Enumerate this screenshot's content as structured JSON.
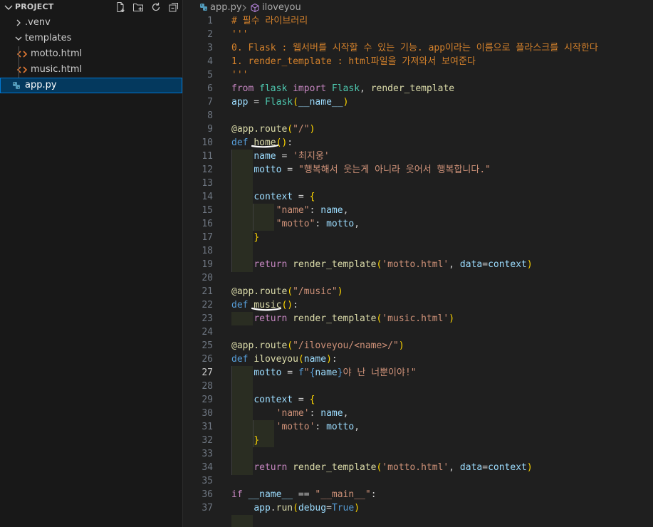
{
  "explorer": {
    "title": "PROJECT",
    "actions": [
      {
        "name": "new-file-icon"
      },
      {
        "name": "new-folder-icon"
      },
      {
        "name": "refresh-icon"
      },
      {
        "name": "collapse-all-icon"
      }
    ],
    "items": [
      {
        "label": ".venv",
        "type": "folder",
        "expanded": false
      },
      {
        "label": "templates",
        "type": "folder",
        "expanded": true
      },
      {
        "label": "motto.html",
        "type": "html"
      },
      {
        "label": "music.html",
        "type": "html"
      },
      {
        "label": "app.py",
        "type": "python",
        "selected": true
      }
    ]
  },
  "breadcrumb": {
    "file": "app.py",
    "symbol": "iloveyou"
  },
  "editor": {
    "active_line": 27,
    "lines": [
      [
        [
          "t-comment",
          "# 필수 라이브러리"
        ]
      ],
      [
        [
          "t-comment",
          "'''"
        ]
      ],
      [
        [
          "t-comment",
          "0. Flask : 웹서버를 시작할 수 있는 기능. app이라는 이름으로 플라스크를 시작한다"
        ]
      ],
      [
        [
          "t-comment",
          "1. render_template : html파일을 가져와서 보여준다"
        ]
      ],
      [
        [
          "t-comment",
          "'''"
        ]
      ],
      [
        [
          "t-ctrl",
          "from"
        ],
        [
          "t-plain",
          " "
        ],
        [
          "t-cls",
          "flask"
        ],
        [
          "t-plain",
          " "
        ],
        [
          "t-ctrl",
          "import"
        ],
        [
          "t-plain",
          " "
        ],
        [
          "t-cls",
          "Flask"
        ],
        [
          "t-plain",
          ", "
        ],
        [
          "t-fn",
          "render_template"
        ]
      ],
      [
        [
          "t-var",
          "app"
        ],
        [
          "t-plain",
          " = "
        ],
        [
          "t-cls",
          "Flask"
        ],
        [
          "t-br1",
          "("
        ],
        [
          "t-var",
          "__name__"
        ],
        [
          "t-br1",
          ")"
        ]
      ],
      [],
      [
        [
          "t-fn",
          "@app.route"
        ],
        [
          "t-br1",
          "("
        ],
        [
          "t-str",
          "\"/\""
        ],
        [
          "t-br1",
          ")"
        ]
      ],
      [
        [
          "t-kw",
          "def"
        ],
        [
          "t-plain",
          " "
        ],
        [
          "t-fn",
          "home"
        ],
        [
          "t-br1",
          "()"
        ],
        [
          "t-plain",
          ":"
        ]
      ],
      [
        [
          "t-plain",
          "    "
        ],
        [
          "t-var",
          "name"
        ],
        [
          "t-plain",
          " = "
        ],
        [
          "t-str",
          "'최지웅'"
        ]
      ],
      [
        [
          "t-plain",
          "    "
        ],
        [
          "t-var",
          "motto"
        ],
        [
          "t-plain",
          " = "
        ],
        [
          "t-str",
          "\"행복해서 웃는게 아니라 웃어서 행복합니다.\""
        ]
      ],
      [],
      [
        [
          "t-plain",
          "    "
        ],
        [
          "t-var",
          "context"
        ],
        [
          "t-plain",
          " = "
        ],
        [
          "t-br1",
          "{"
        ]
      ],
      [
        [
          "t-plain",
          "        "
        ],
        [
          "t-str",
          "\"name\""
        ],
        [
          "t-plain",
          ": "
        ],
        [
          "t-var",
          "name"
        ],
        [
          "t-plain",
          ","
        ]
      ],
      [
        [
          "t-plain",
          "        "
        ],
        [
          "t-str",
          "\"motto\""
        ],
        [
          "t-plain",
          ": "
        ],
        [
          "t-var",
          "motto"
        ],
        [
          "t-plain",
          ","
        ]
      ],
      [
        [
          "t-plain",
          "    "
        ],
        [
          "t-br1",
          "}"
        ]
      ],
      [],
      [
        [
          "t-plain",
          "    "
        ],
        [
          "t-ctrl",
          "return"
        ],
        [
          "t-plain",
          " "
        ],
        [
          "t-fn",
          "render_template"
        ],
        [
          "t-br1",
          "("
        ],
        [
          "t-str",
          "'motto.html'"
        ],
        [
          "t-plain",
          ", "
        ],
        [
          "t-var",
          "data"
        ],
        [
          "t-plain",
          "="
        ],
        [
          "t-var",
          "context"
        ],
        [
          "t-br1",
          ")"
        ]
      ],
      [],
      [
        [
          "t-fn",
          "@app.route"
        ],
        [
          "t-br1",
          "("
        ],
        [
          "t-str",
          "\"/music\""
        ],
        [
          "t-br1",
          ")"
        ]
      ],
      [
        [
          "t-kw",
          "def"
        ],
        [
          "t-plain",
          " "
        ],
        [
          "t-fn",
          "music"
        ],
        [
          "t-br1",
          "()"
        ],
        [
          "t-plain",
          ":"
        ]
      ],
      [
        [
          "t-plain",
          "    "
        ],
        [
          "t-ctrl",
          "return"
        ],
        [
          "t-plain",
          " "
        ],
        [
          "t-fn",
          "render_template"
        ],
        [
          "t-br1",
          "("
        ],
        [
          "t-str",
          "'music.html'"
        ],
        [
          "t-br1",
          ")"
        ]
      ],
      [],
      [
        [
          "t-fn",
          "@app.route"
        ],
        [
          "t-br1",
          "("
        ],
        [
          "t-str",
          "\"/iloveyou/<name>/\""
        ],
        [
          "t-br1",
          ")"
        ]
      ],
      [
        [
          "t-kw",
          "def"
        ],
        [
          "t-plain",
          " "
        ],
        [
          "t-fn",
          "iloveyou"
        ],
        [
          "t-br1",
          "("
        ],
        [
          "t-var",
          "name"
        ],
        [
          "t-br1",
          ")"
        ],
        [
          "t-plain",
          ":"
        ]
      ],
      [
        [
          "t-plain",
          "    "
        ],
        [
          "t-var",
          "motto"
        ],
        [
          "t-plain",
          " = "
        ],
        [
          "t-kw",
          "f"
        ],
        [
          "t-str",
          "\""
        ],
        [
          "t-kw",
          "{"
        ],
        [
          "t-var",
          "name"
        ],
        [
          "t-kw",
          "}"
        ],
        [
          "t-str",
          "야 난 너뿐이야!\""
        ]
      ],
      [],
      [
        [
          "t-plain",
          "    "
        ],
        [
          "t-var",
          "context"
        ],
        [
          "t-plain",
          " = "
        ],
        [
          "t-br1",
          "{"
        ]
      ],
      [
        [
          "t-plain",
          "        "
        ],
        [
          "t-str",
          "'name'"
        ],
        [
          "t-plain",
          ": "
        ],
        [
          "t-var",
          "name"
        ],
        [
          "t-plain",
          ","
        ]
      ],
      [
        [
          "t-plain",
          "        "
        ],
        [
          "t-str",
          "'motto'"
        ],
        [
          "t-plain",
          ": "
        ],
        [
          "t-var",
          "motto"
        ],
        [
          "t-plain",
          ","
        ]
      ],
      [
        [
          "t-plain",
          "    "
        ],
        [
          "t-br1",
          "}"
        ]
      ],
      [],
      [
        [
          "t-plain",
          "    "
        ],
        [
          "t-ctrl",
          "return"
        ],
        [
          "t-plain",
          " "
        ],
        [
          "t-fn",
          "render_template"
        ],
        [
          "t-br1",
          "("
        ],
        [
          "t-str",
          "'motto.html'"
        ],
        [
          "t-plain",
          ", "
        ],
        [
          "t-var",
          "data"
        ],
        [
          "t-plain",
          "="
        ],
        [
          "t-var",
          "context"
        ],
        [
          "t-br1",
          ")"
        ]
      ],
      [],
      [
        [
          "t-ctrl",
          "if"
        ],
        [
          "t-plain",
          " "
        ],
        [
          "t-var",
          "__name__"
        ],
        [
          "t-plain",
          " == "
        ],
        [
          "t-str",
          "\"__main__\""
        ],
        [
          "t-plain",
          ":"
        ]
      ],
      [
        [
          "t-plain",
          "    "
        ],
        [
          "t-var",
          "app"
        ],
        [
          "t-plain",
          "."
        ],
        [
          "t-fn",
          "run"
        ],
        [
          "t-br1",
          "("
        ],
        [
          "t-var",
          "debug"
        ],
        [
          "t-plain",
          "="
        ],
        [
          "t-const",
          "True"
        ],
        [
          "t-br1",
          ")"
        ]
      ]
    ]
  },
  "colors": {
    "selection_bg": "#04395e",
    "selection_border": "#0078d4",
    "python_icon": "#519aba",
    "html_icon": "#e37933",
    "pen": "#ffffff"
  }
}
